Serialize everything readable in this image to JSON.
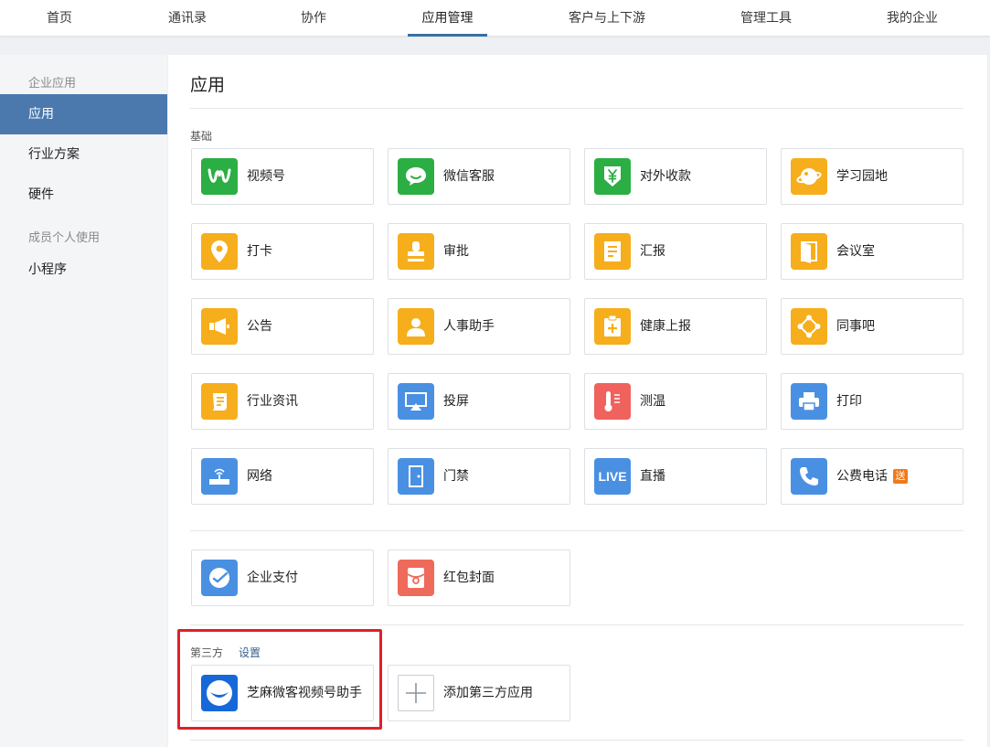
{
  "nav": {
    "tabs": [
      {
        "label": "首页"
      },
      {
        "label": "通讯录"
      },
      {
        "label": "协作"
      },
      {
        "label": "应用管理"
      },
      {
        "label": "客户与上下游"
      },
      {
        "label": "管理工具"
      },
      {
        "label": "我的企业"
      }
    ],
    "active": "应用管理"
  },
  "sidebar": {
    "group1": "企业应用",
    "items": [
      "应用",
      "行业方案",
      "硬件"
    ],
    "group2": "成员个人使用",
    "items2": [
      "小程序"
    ]
  },
  "main": {
    "title": "应用",
    "basic_label": "基础",
    "apps": [
      {
        "label": "视频号",
        "icon": "wechat-channels-icon",
        "color": "#2bae43"
      },
      {
        "label": "微信客服",
        "icon": "wechat-service-icon",
        "color": "#2bae43"
      },
      {
        "label": "对外收款",
        "icon": "yuan-shield-icon",
        "color": "#2bae43"
      },
      {
        "label": "学习园地",
        "icon": "planet-icon",
        "color": "#f6ae1c"
      },
      {
        "label": "打卡",
        "icon": "location-pin-icon",
        "color": "#f6ae1c"
      },
      {
        "label": "审批",
        "icon": "stamp-icon",
        "color": "#f6ae1c"
      },
      {
        "label": "汇报",
        "icon": "report-icon",
        "color": "#f6ae1c"
      },
      {
        "label": "会议室",
        "icon": "door-icon",
        "color": "#f6ae1c"
      },
      {
        "label": "公告",
        "icon": "megaphone-icon",
        "color": "#f6ae1c"
      },
      {
        "label": "人事助手",
        "icon": "person-icon",
        "color": "#f6ae1c"
      },
      {
        "label": "健康上报",
        "icon": "health-clipboard-icon",
        "color": "#f6ae1c"
      },
      {
        "label": "同事吧",
        "icon": "network-icon",
        "color": "#f6ae1c"
      },
      {
        "label": "行业资讯",
        "icon": "scroll-icon",
        "color": "#f6ae1c"
      },
      {
        "label": "投屏",
        "icon": "airplay-icon",
        "color": "#4a90e2"
      },
      {
        "label": "测温",
        "icon": "thermometer-icon",
        "color": "#f0625d"
      },
      {
        "label": "打印",
        "icon": "printer-icon",
        "color": "#4a90e2"
      },
      {
        "label": "网络",
        "icon": "router-icon",
        "color": "#4a90e2"
      },
      {
        "label": "门禁",
        "icon": "access-door-icon",
        "color": "#4a90e2"
      },
      {
        "label": "直播",
        "icon": "live-icon",
        "color": "#4a90e2",
        "icon_text": "LIVE"
      },
      {
        "label": "公费电话",
        "icon": "phone-icon",
        "color": "#4a90e2",
        "badge": "送"
      }
    ],
    "pay_apps": [
      {
        "label": "企业支付",
        "icon": "pay-icon",
        "color": "#4a90e2"
      },
      {
        "label": "红包封面",
        "icon": "red-envelope-icon",
        "color": "#ee6a5a"
      }
    ],
    "third_party_label": "第三方",
    "settings_link": "设置",
    "third_party_apps": [
      {
        "label": "芝麻微客视频号助手",
        "icon": "smile-logo-icon",
        "color": "#1668d8"
      }
    ],
    "add_third_party": "添加第三方应用"
  }
}
